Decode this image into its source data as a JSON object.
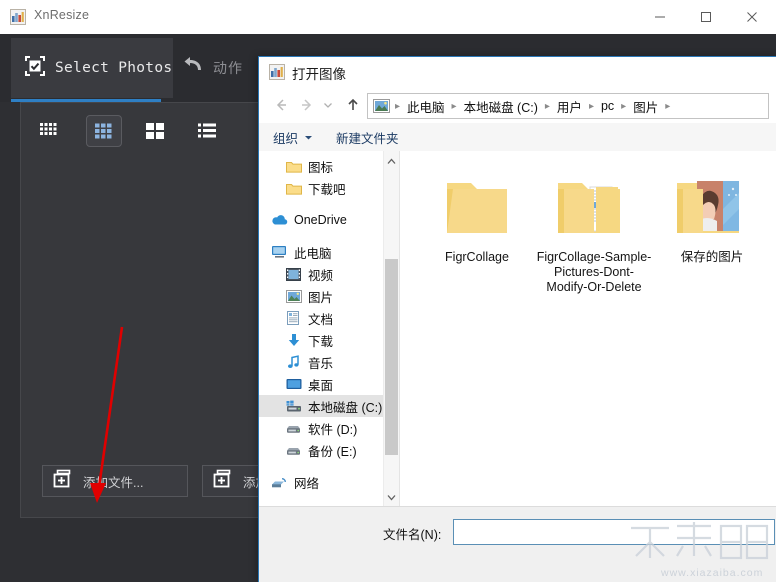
{
  "app": {
    "title": "XnResize",
    "title_icon": "app-logo-icon",
    "window_controls": {
      "minimize": "minimize-icon",
      "maximize": "maximize-icon",
      "close": "close-icon"
    }
  },
  "tabs": [
    {
      "id": "select-photos",
      "label": "Select Photos",
      "icon": "checkbox-frame-icon",
      "active": true
    },
    {
      "id": "action",
      "label": "动作",
      "icon": "undo-arrow-icon",
      "active": false
    }
  ],
  "view_modes": [
    {
      "id": "small-grid",
      "icon": "small-grid-icon",
      "active": false
    },
    {
      "id": "medium-grid",
      "icon": "medium-grid-icon",
      "active": true
    },
    {
      "id": "large-grid",
      "icon": "large-grid-icon",
      "active": false
    },
    {
      "id": "list-view",
      "icon": "list-view-icon",
      "active": false
    }
  ],
  "panel_buttons": [
    {
      "id": "add-files",
      "label": "添加文件...",
      "icon": "add-file-icon"
    },
    {
      "id": "add-folder",
      "label": "添加文件夹...",
      "icon": "add-folder-icon"
    }
  ],
  "annotation": {
    "type": "red-arrow",
    "color": "#e00000",
    "points_to": "add-files"
  },
  "dialog": {
    "title": "打开图像",
    "title_icon": "app-logo-icon",
    "nav": {
      "back": "back-arrow-icon",
      "forward": "forward-arrow-icon",
      "recent": "chevron-down-icon",
      "up": "up-arrow-icon"
    },
    "breadcrumb": {
      "leading_icon": "picture-icon",
      "items": [
        "此电脑",
        "本地磁盘 (C:)",
        "用户",
        "pc",
        "图片"
      ]
    },
    "commands": [
      {
        "id": "organize",
        "label": "组织",
        "has_dropdown": true
      },
      {
        "id": "new-folder",
        "label": "新建文件夹",
        "has_dropdown": false
      }
    ],
    "tree": [
      {
        "label": "图标",
        "icon": "folder-icon",
        "indent": "child",
        "selected": false
      },
      {
        "label": "下载吧",
        "icon": "folder-icon",
        "indent": "child",
        "selected": false
      },
      {
        "gap": true
      },
      {
        "label": "OneDrive",
        "icon": "onedrive-cloud-icon",
        "indent": "root",
        "selected": false
      },
      {
        "gap": true
      },
      {
        "label": "此电脑",
        "icon": "this-pc-icon",
        "indent": "root",
        "selected": false
      },
      {
        "label": "视频",
        "icon": "videos-icon",
        "indent": "child",
        "selected": false
      },
      {
        "label": "图片",
        "icon": "pictures-icon",
        "indent": "child",
        "selected": false
      },
      {
        "label": "文档",
        "icon": "documents-icon",
        "indent": "child",
        "selected": false
      },
      {
        "label": "下载",
        "icon": "downloads-icon",
        "indent": "child",
        "selected": false
      },
      {
        "label": "音乐",
        "icon": "music-icon",
        "indent": "child",
        "selected": false
      },
      {
        "label": "桌面",
        "icon": "desktop-icon",
        "indent": "child",
        "selected": false
      },
      {
        "label": "本地磁盘 (C:)",
        "icon": "windows-drive-icon",
        "indent": "child",
        "selected": true
      },
      {
        "label": "软件 (D:)",
        "icon": "drive-icon",
        "indent": "child",
        "selected": false
      },
      {
        "label": "备份 (E:)",
        "icon": "drive-icon",
        "indent": "child",
        "selected": false
      },
      {
        "gap": true
      },
      {
        "label": "网络",
        "icon": "network-icon",
        "indent": "root",
        "selected": false
      }
    ],
    "files": [
      {
        "name": "FigrCollage",
        "kind": "folder-plain"
      },
      {
        "name": "FigrCollage-Sample-Pictures-Dont-Modify-Or-Delete",
        "kind": "folder-documents"
      },
      {
        "name": "保存的图片",
        "kind": "folder-pictures"
      }
    ],
    "filename": {
      "label": "文件名(N):",
      "value": "",
      "placeholder": ""
    }
  },
  "watermark": {
    "text": "下载吧",
    "url": "www.xiazaiba.com"
  },
  "colors": {
    "app_bg": "#2e2f33",
    "panel_bg": "#37383c",
    "tab_active_bg": "#3a3b40",
    "accent_blue": "#2e7fc4",
    "dialog_border": "#2a78b8",
    "arrow_red": "#e00000",
    "folder_yellow": "#f6d882"
  }
}
